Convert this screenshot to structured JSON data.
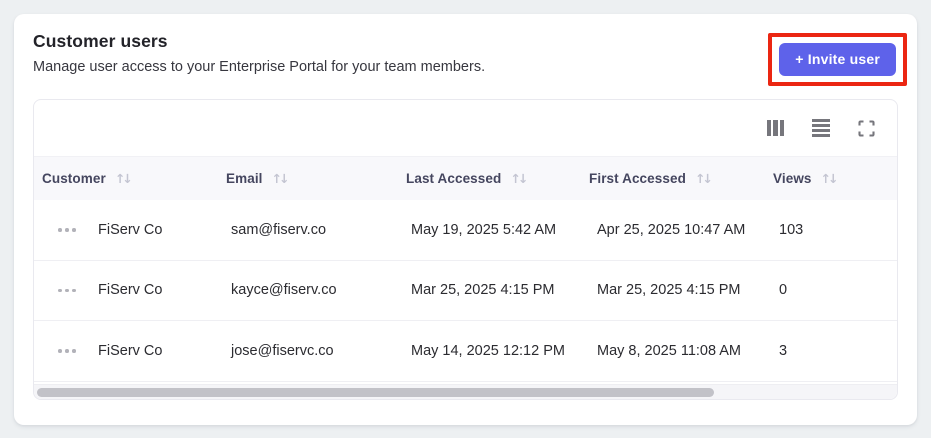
{
  "colors": {
    "page_bg": "#EDF0F2",
    "accent": "#5E62EA",
    "annotation_red": "#EB2612",
    "table_header_bg": "#F8F8FB"
  },
  "header": {
    "title": "Customer users",
    "subtitle": "Manage user access to your Enterprise Portal for your team members.",
    "invite_button_label": "+ Invite user"
  },
  "annotation": {
    "type": "highlight-box",
    "target": "invite-user-button",
    "color": "#EB2612"
  },
  "toolbar": {
    "icons": [
      "columns-view-icon",
      "list-view-icon",
      "fullscreen-icon"
    ]
  },
  "table": {
    "sort_glyph": "↑↓",
    "columns": [
      {
        "label": "Customer",
        "sortable": true
      },
      {
        "label": "Email",
        "sortable": true
      },
      {
        "label": "Last Accessed",
        "sortable": true
      },
      {
        "label": "First Accessed",
        "sortable": true
      },
      {
        "label": "Views",
        "sortable": true
      }
    ],
    "rows": [
      {
        "customer": "FiServ Co",
        "email": "sam@fiserv.co",
        "last_accessed": "May 19, 2025 5:42 AM",
        "first_accessed": "Apr 25, 2025 10:47 AM",
        "views": "103"
      },
      {
        "customer": "FiServ Co",
        "email": "kayce@fiserv.co",
        "last_accessed": "Mar 25, 2025 4:15 PM",
        "first_accessed": "Mar 25, 2025 4:15 PM",
        "views": "0"
      },
      {
        "customer": "FiServ Co",
        "email": "jose@fiservc.co",
        "last_accessed": "May 14, 2025 12:12 PM",
        "first_accessed": "May 8, 2025 11:08 AM",
        "views": "3"
      }
    ]
  },
  "scrollbar": {
    "orientation": "horizontal",
    "thumb_fraction": 0.79
  }
}
